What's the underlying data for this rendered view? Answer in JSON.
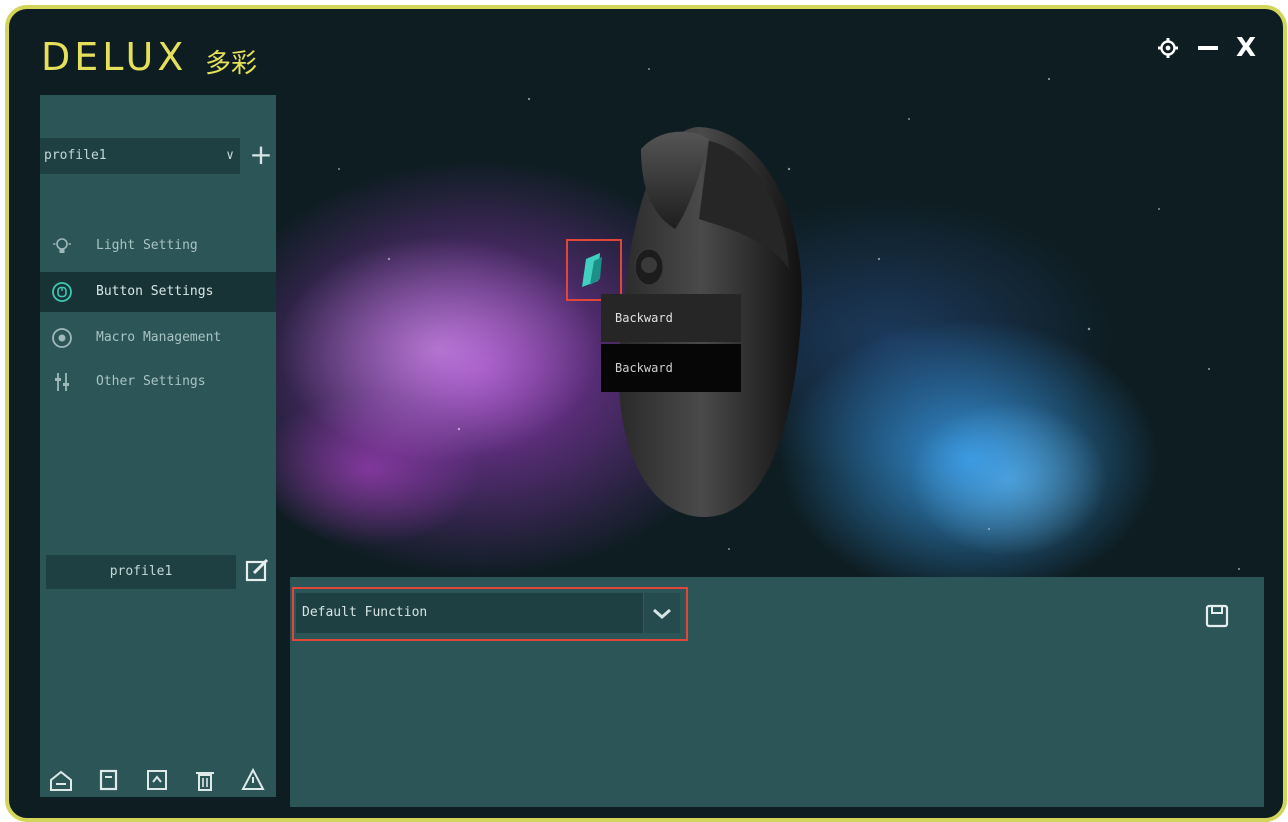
{
  "app": {
    "brand": "DELUX",
    "brand_cn": "多彩",
    "window_controls": {
      "settings_icon": "gear-icon",
      "minimize_icon": "minimize-icon",
      "close_label": "X"
    }
  },
  "sidebar": {
    "profile_select": {
      "value": "profile1",
      "chevron": "∨"
    },
    "add_profile_label": "+",
    "nav": [
      {
        "label": "Light Setting",
        "icon": "light-bulb-icon"
      },
      {
        "label": "Button Settings",
        "icon": "mouse-button-icon",
        "active": true
      },
      {
        "label": "Macro Management",
        "icon": "macro-icon"
      },
      {
        "label": "Other Settings",
        "icon": "sliders-icon"
      }
    ],
    "profile_name": "profile1",
    "bottom_icons": [
      "import-icon",
      "copy-icon",
      "export-icon",
      "trash-icon",
      "reset-icon"
    ]
  },
  "mouse_view": {
    "popup_items": [
      "Backward",
      "Backward"
    ]
  },
  "panel": {
    "function_select": {
      "value": "Default Function"
    }
  },
  "colors": {
    "frame_border": "#d3d45a",
    "sidebar_bg": "#2c5558",
    "highlight": "#e0463a",
    "logo": "#e4e05a"
  }
}
